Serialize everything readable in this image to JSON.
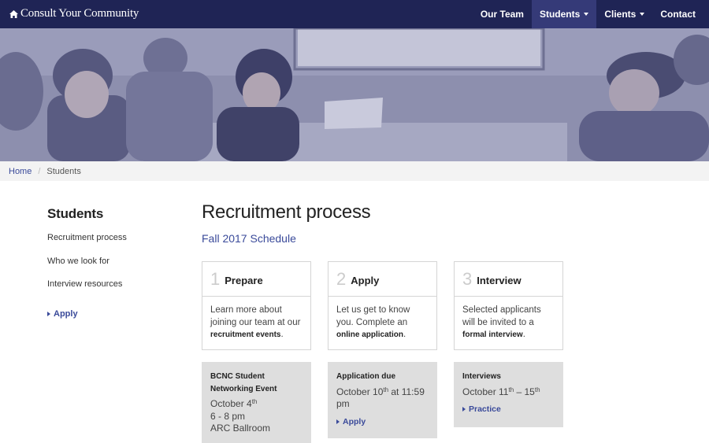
{
  "navbar": {
    "brand": "Consult Your Community",
    "items": [
      {
        "label": "Our Team"
      },
      {
        "label": "Students"
      },
      {
        "label": "Clients"
      },
      {
        "label": "Contact"
      }
    ]
  },
  "breadcrumb": {
    "home": "Home",
    "current": "Students"
  },
  "sidebar": {
    "title": "Students",
    "links": [
      "Recruitment process",
      "Who we look for",
      "Interview resources"
    ],
    "apply": "Apply"
  },
  "main": {
    "title": "Recruitment process",
    "subtitle": "Fall 2017 Schedule"
  },
  "steps": [
    {
      "num": "1",
      "title": "Prepare",
      "text1": "Learn more about joining our team at our ",
      "bold1": "recruitment events",
      "text2": "."
    },
    {
      "num": "2",
      "title": "Apply",
      "text1": "Let us get to know you. Complete an ",
      "bold1": "online application",
      "text2": "."
    },
    {
      "num": "3",
      "title": "Interview",
      "text1": "Selected applicants will be invited to a ",
      "bold1": "formal interview",
      "text2": "."
    }
  ],
  "events": [
    {
      "title": "BCNC Student Networking Event",
      "date": "October 4",
      "date_sup": "th",
      "time": "6 - 8 pm",
      "place": "ARC Ballroom"
    },
    {
      "title": "Application due",
      "date": "October 10",
      "date_sup": "th",
      "date_rest": " at 11:59 pm",
      "link": "Apply"
    },
    {
      "title": "Interviews",
      "date": "October 11",
      "date_sup": "th",
      "date_mid": " – 15",
      "date_sup2": "th",
      "link": "Practice"
    }
  ],
  "colors": {
    "navbar": "#1f2455",
    "active_nav": "#353a78",
    "accent": "#3a4a9a",
    "hero_tint": "#8a8cab"
  }
}
